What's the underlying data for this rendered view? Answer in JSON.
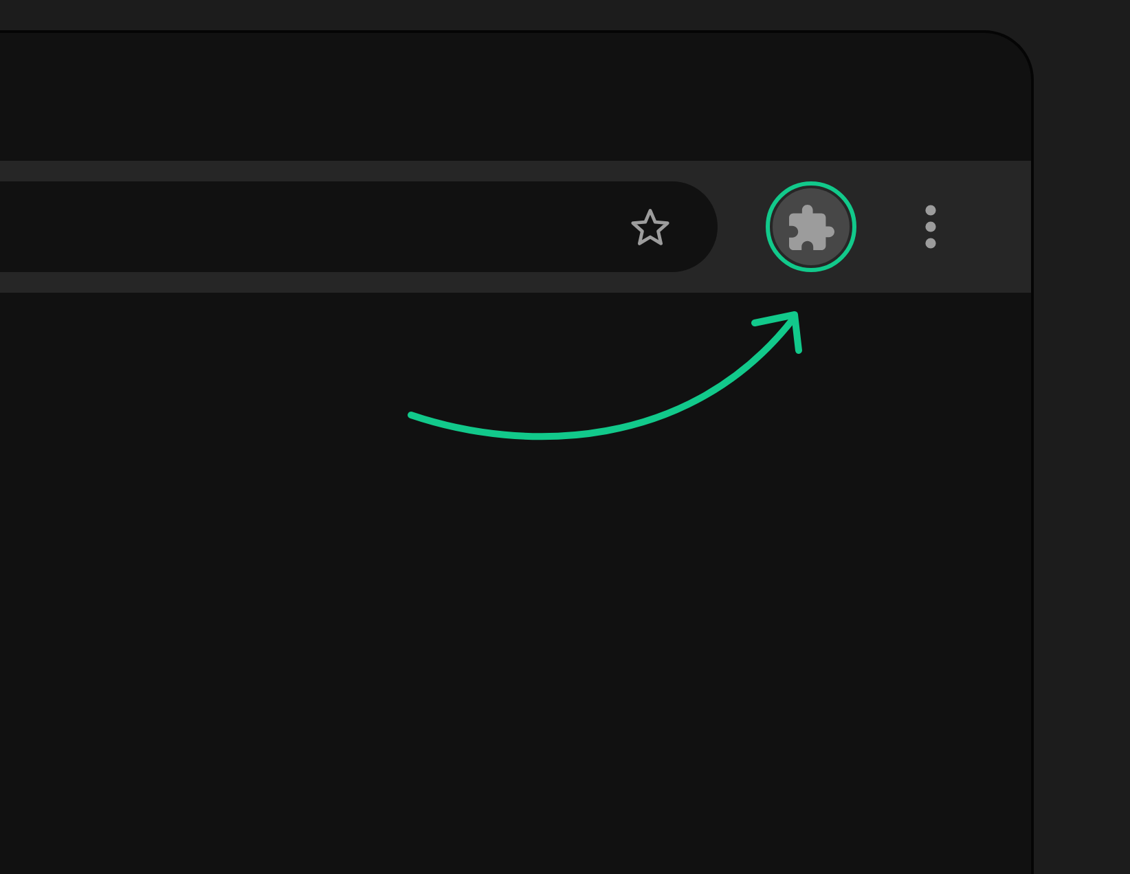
{
  "toolbar": {
    "address_bar": {
      "actions": [
        {
          "kind": "star"
        }
      ]
    },
    "buttons": [
      {
        "kind": "extensions",
        "highlighted": true
      },
      {
        "kind": "menu",
        "highlighted": false
      }
    ]
  },
  "annotations": [
    {
      "kind": "curved-arrow"
    }
  ]
}
